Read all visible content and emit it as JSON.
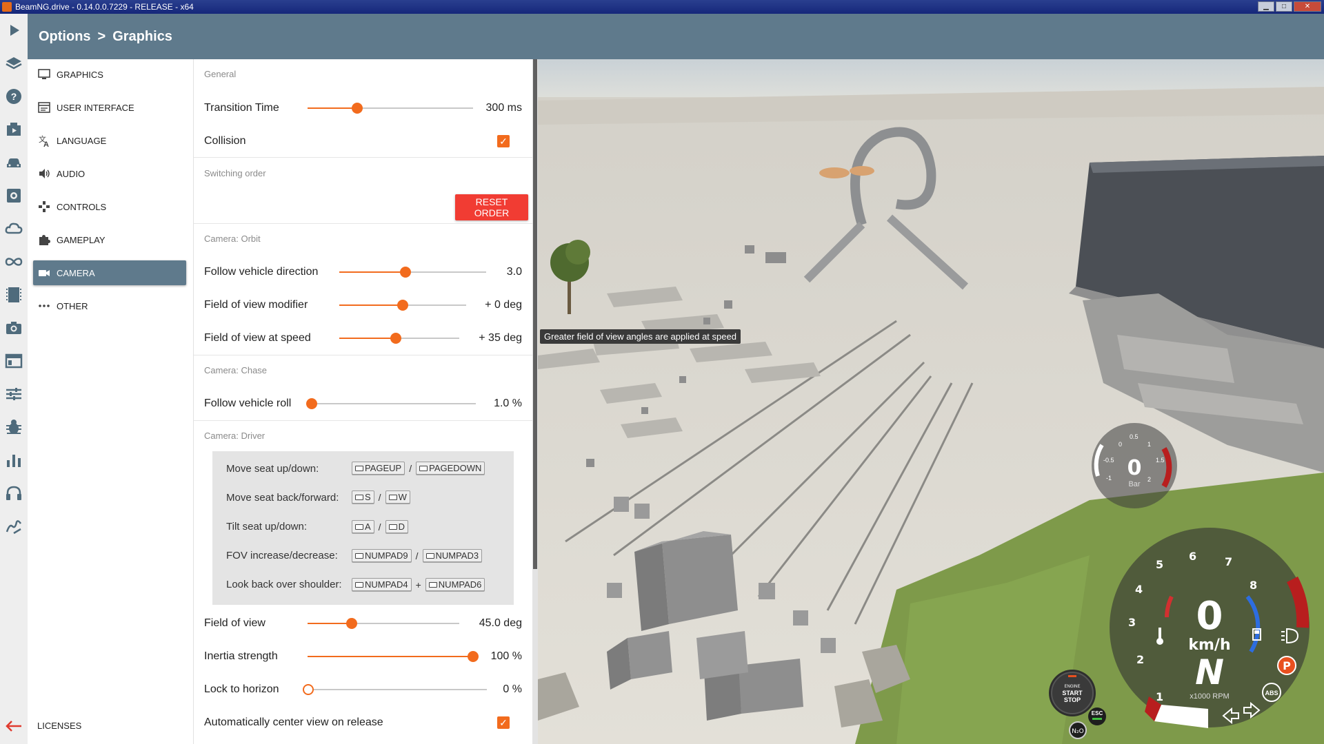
{
  "window": {
    "title": "BeamNG.drive - 0.14.0.0.7229 - RELEASE - x64"
  },
  "breadcrumb": {
    "root": "Options",
    "separator": ">",
    "current": "Graphics"
  },
  "iconbar": {
    "items": [
      "play-icon",
      "layers-icon",
      "help-icon",
      "missions-icon",
      "vehicles-icon",
      "vehicle-config-icon",
      "environment-icon",
      "track-builder-icon",
      "replay-icon",
      "photo-mode-icon",
      "ui-apps-icon",
      "settings-sliders-icon",
      "debug-icon",
      "performance-icon",
      "audio-headset-icon",
      "road-editor-icon",
      "back-arrow-icon"
    ]
  },
  "nav": {
    "items": [
      {
        "label": "GRAPHICS",
        "icon": "monitor-icon"
      },
      {
        "label": "USER INTERFACE",
        "icon": "interface-icon"
      },
      {
        "label": "LANGUAGE",
        "icon": "translate-icon"
      },
      {
        "label": "AUDIO",
        "icon": "speaker-icon"
      },
      {
        "label": "CONTROLS",
        "icon": "gamepad-icon"
      },
      {
        "label": "GAMEPLAY",
        "icon": "puzzle-icon"
      },
      {
        "label": "CAMERA",
        "icon": "camera-icon",
        "active": true
      },
      {
        "label": "OTHER",
        "icon": "more-dots-icon"
      }
    ],
    "licenses": "LICENSES"
  },
  "settings": {
    "general": {
      "label": "General",
      "transition_time": {
        "label": "Transition Time",
        "value": "300 ms",
        "fraction": 0.3
      },
      "collision": {
        "label": "Collision",
        "checked": true
      }
    },
    "switching": {
      "label": "Switching order",
      "reset_label": "RESET ORDER"
    },
    "orbit": {
      "label": "Camera: Orbit",
      "follow_direction": {
        "label": "Follow vehicle direction",
        "value": "3.0",
        "fraction": 0.45
      },
      "fov_modifier": {
        "label": "Field of view modifier",
        "value": "+ 0 deg",
        "fraction": 0.5
      },
      "fov_speed": {
        "label": "Field of view at speed",
        "value": "+ 35 deg",
        "fraction": 0.47
      }
    },
    "chase": {
      "label": "Camera: Chase",
      "follow_roll": {
        "label": "Follow vehicle roll",
        "value": "1.0 %",
        "fraction": 0.01
      }
    },
    "driver": {
      "label": "Camera: Driver",
      "bindings": [
        {
          "label": "Move seat up/down:",
          "key1": "PAGEUP",
          "sep": "/",
          "key2": "PAGEDOWN"
        },
        {
          "label": "Move seat back/forward:",
          "key1": "S",
          "sep": "/",
          "key2": "W"
        },
        {
          "label": "Tilt seat up/down:",
          "key1": "A",
          "sep": "/",
          "key2": "D"
        },
        {
          "label": "FOV increase/decrease:",
          "key1": "NUMPAD9",
          "sep": "/",
          "key2": "NUMPAD3"
        },
        {
          "label": "Look back over shoulder:",
          "key1": "NUMPAD4",
          "sep": "+",
          "key2": "NUMPAD6"
        }
      ],
      "fov": {
        "label": "Field of view",
        "value": "45.0 deg",
        "fraction": 0.29
      },
      "inertia": {
        "label": "Inertia strength",
        "value": "100 %",
        "fraction": 1.0
      },
      "lock_horizon": {
        "label": "Lock to horizon",
        "value": "0 %",
        "fraction": 0.0
      },
      "auto_center": {
        "label": "Automatically center view on release",
        "checked": true
      }
    }
  },
  "tooltip": "Greater field of view angles are applied at speed",
  "hud": {
    "boost": {
      "value": "0",
      "unit": "Bar",
      "ticks": [
        "0",
        "0.5",
        "1",
        "1.5",
        "2",
        "-0.5",
        "-1"
      ]
    },
    "speed": {
      "value": "0",
      "unit": "km/h"
    },
    "gear": "N",
    "rpm_unit": "x1000 RPM",
    "rpm_ticks": [
      "1",
      "2",
      "3",
      "4",
      "5",
      "6",
      "7",
      "8"
    ],
    "park": "P",
    "abs": "ABS",
    "engine": {
      "line1": "ENGINE",
      "line2": "START",
      "line3": "STOP"
    },
    "esc": "ESC",
    "nos": "N₂O"
  },
  "colors": {
    "accent": "#f26b1d",
    "header": "#5f7a8c",
    "danger": "#f13c33"
  }
}
